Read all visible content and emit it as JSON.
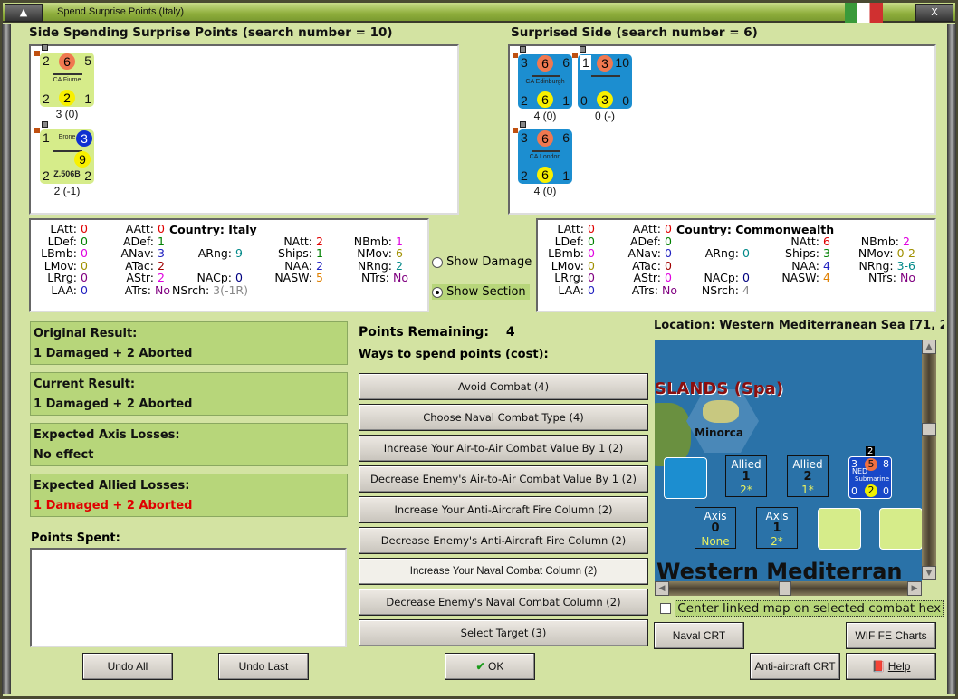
{
  "window": {
    "title": "Spend Surprise Points (Italy)",
    "close_label": "X"
  },
  "left_side": {
    "header": "Side Spending Surprise Points (search number = 10)",
    "counters": [
      {
        "kind": "ship",
        "color": "#d6ec8a",
        "tl": "2",
        "tm": "6",
        "tr": "5",
        "name": "CA Fiume",
        "bl": "2",
        "bm": "2",
        "br": "1",
        "caption": "3 (0)"
      },
      {
        "kind": "air",
        "color": "#d6ec8a",
        "tl": "1",
        "tm": "3",
        "tr": "",
        "name": "Erone",
        "bl": "2",
        "bm": "9",
        "br": "2",
        "sub": "Z.506B",
        "caption": "2 (-1)"
      }
    ]
  },
  "right_side": {
    "header": "Surprised Side (search number = 6)",
    "counters": [
      {
        "kind": "ship",
        "color": "#1c8ed0",
        "tl": "3",
        "tm": "6",
        "tr": "6",
        "name": "CA Edinburgh",
        "bl": "2",
        "bm": "6",
        "br": "1",
        "caption": "4 (0)"
      },
      {
        "kind": "ship",
        "color": "#1c8ed0",
        "tl": "1",
        "tm": "3",
        "tr": "10",
        "name": "",
        "bl": "0",
        "bm": "3",
        "br": "0",
        "caption": "0 (-)"
      },
      {
        "kind": "ship",
        "color": "#1c8ed0",
        "tl": "3",
        "tm": "6",
        "tr": "6",
        "name": "CA London",
        "bl": "2",
        "bm": "6",
        "br": "1",
        "caption": "4 (0)"
      }
    ]
  },
  "left_stats": {
    "country": "Country: Italy",
    "columns": [
      [
        [
          "LAtt:",
          "0",
          "#e00000"
        ],
        [
          "LDef:",
          "0",
          "#008000"
        ],
        [
          "LBmb:",
          "0",
          "#e000e0"
        ],
        [
          "LMov:",
          "0",
          "#a09000"
        ],
        [
          "LRrg:",
          "0",
          "#800080"
        ],
        [
          "LAA:",
          "0",
          "#2020c0"
        ]
      ],
      [
        [
          "AAtt:",
          "0",
          "#e00000"
        ],
        [
          "ADef:",
          "1",
          "#008000"
        ],
        [
          "ANav:",
          "3",
          "#2020c0"
        ],
        [
          "ATac:",
          "2",
          "#a00000"
        ],
        [
          "AStr:",
          "2",
          "#e000e0"
        ],
        [
          "ATrs:",
          "No",
          "#800080"
        ]
      ],
      [
        null,
        null,
        [
          "ARng:",
          "9",
          "#008888"
        ],
        null,
        [
          "NACp:",
          "0",
          "#000080"
        ],
        [
          "NSrch:",
          "3(-1R)",
          "#888888"
        ]
      ],
      [
        null,
        [
          "NAtt:",
          "2",
          "#e00000"
        ],
        [
          "Ships:",
          "1",
          "#008000"
        ],
        [
          "NAA:",
          "2",
          "#2020c0"
        ],
        [
          "NASW:",
          "5",
          "#e08000"
        ],
        null
      ],
      [
        null,
        [
          "NBmb:",
          "1",
          "#e000e0"
        ],
        [
          "NMov:",
          "6",
          "#a09000"
        ],
        [
          "NRng:",
          "2",
          "#008888"
        ],
        [
          "NTrs:",
          "No",
          "#800080"
        ],
        null
      ]
    ]
  },
  "right_stats": {
    "country": "Country: Commonwealth",
    "columns": [
      [
        [
          "LAtt:",
          "0",
          "#e00000"
        ],
        [
          "LDef:",
          "0",
          "#008000"
        ],
        [
          "LBmb:",
          "0",
          "#e000e0"
        ],
        [
          "LMov:",
          "0",
          "#a09000"
        ],
        [
          "LRrg:",
          "0",
          "#800080"
        ],
        [
          "LAA:",
          "0",
          "#2020c0"
        ]
      ],
      [
        [
          "AAtt:",
          "0",
          "#e00000"
        ],
        [
          "ADef:",
          "0",
          "#008000"
        ],
        [
          "ANav:",
          "0",
          "#2020c0"
        ],
        [
          "ATac:",
          "0",
          "#a00000"
        ],
        [
          "AStr:",
          "0",
          "#e000e0"
        ],
        [
          "ATrs:",
          "No",
          "#800080"
        ]
      ],
      [
        null,
        null,
        [
          "ARng:",
          "0",
          "#008888"
        ],
        null,
        [
          "NACp:",
          "0",
          "#000080"
        ],
        [
          "NSrch:",
          "4",
          "#888888"
        ]
      ],
      [
        null,
        [
          "NAtt:",
          "6",
          "#e00000"
        ],
        [
          "Ships:",
          "3",
          "#008000"
        ],
        [
          "NAA:",
          "4",
          "#2020c0"
        ],
        [
          "NASW:",
          "4",
          "#e08000"
        ],
        null
      ],
      [
        null,
        [
          "NBmb:",
          "2",
          "#e000e0"
        ],
        [
          "NMov:",
          "0-2",
          "#a09000"
        ],
        [
          "NRng:",
          "3-6",
          "#008888"
        ],
        [
          "NTrs:",
          "No",
          "#800080"
        ],
        null
      ]
    ]
  },
  "view_options": {
    "show_damage": "Show Damage",
    "show_section": "Show Section",
    "selected": "show_section"
  },
  "results": [
    {
      "label": "Original Result:",
      "value": "1 Damaged + 2 Aborted",
      "color": "#111111"
    },
    {
      "label": "Current Result:",
      "value": "1 Damaged + 2 Aborted",
      "color": "#111111"
    },
    {
      "label": "Expected Axis Losses:",
      "value": "No effect",
      "color": "#111111"
    },
    {
      "label": "Expected Allied Losses:",
      "value": "1 Damaged + 2 Aborted",
      "color": "#e00000"
    }
  ],
  "points_spent": {
    "label": "Points Spent:",
    "value": ""
  },
  "points": {
    "label": "Points Remaining:",
    "value": "4",
    "ways_label": "Ways to spend points (cost):"
  },
  "ways": [
    "Avoid Combat (4)",
    "Choose Naval Combat Type (4)",
    "Increase Your Air-to-Air Combat Value By 1 (2)",
    "Decrease Enemy's Air-to-Air Combat Value By 1 (2)",
    "Increase Your Anti-Aircraft Fire Column (2)",
    "Decrease Enemy's Anti-Aircraft Fire Column (2)",
    "Increase Your Naval Combat Column (2)",
    "Decrease Enemy's Naval Combat Column (2)",
    "Select Target (3)"
  ],
  "map": {
    "location": "Location: Western Mediterranean Sea [71, 2",
    "region_label": "SLANDS (Spa)",
    "island": "Minorca",
    "sea_label": "Western Mediterran",
    "boxes": [
      {
        "side": "Allied",
        "num": "1",
        "val": "2*"
      },
      {
        "side": "Allied",
        "num": "2",
        "val": "1*"
      },
      {
        "side": "Axis",
        "num": "0",
        "val": "None"
      },
      {
        "side": "Axis",
        "num": "1",
        "val": "2*"
      }
    ],
    "sub_counter": {
      "tl": "3",
      "tm": "5",
      "tr": "8",
      "nation": "NED",
      "name": "Submarine",
      "bl": "0",
      "bm": "2",
      "br": "0",
      "stack": "2"
    },
    "center_checkbox": "Center linked map on selected combat hex"
  },
  "buttons": {
    "undo_all": "Undo All",
    "undo_last": "Undo Last",
    "ok": "OK",
    "naval_crt": "Naval CRT",
    "wif_charts": "WIF FE Charts",
    "aa_crt": "Anti-aircraft CRT",
    "help": "Help"
  }
}
